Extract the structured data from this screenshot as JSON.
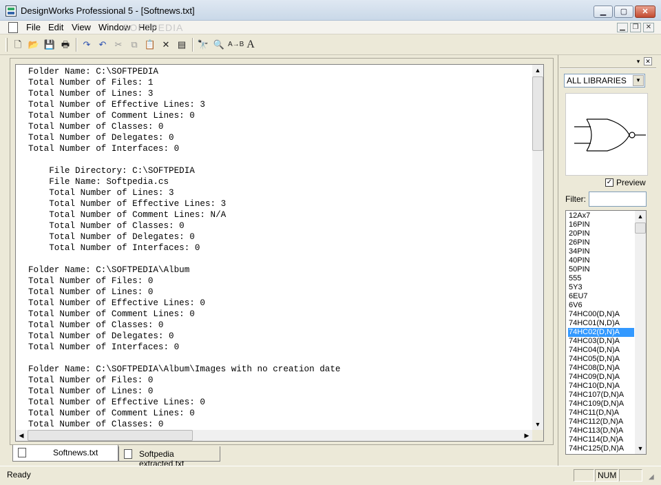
{
  "window": {
    "title": "DesignWorks Professional 5 - [Softnews.txt]"
  },
  "menu": [
    "File",
    "Edit",
    "View",
    "Window",
    "Help"
  ],
  "watermark": "SOFTPEDIA",
  "toolbar": [
    "new-icon",
    "open-icon",
    "save-icon",
    "print-icon",
    "redo-icon",
    "undo-icon",
    "cut-icon",
    "copy-icon",
    "paste-icon",
    "delete-icon",
    "properties-icon",
    "find-icon",
    "find-next-icon",
    "replace-icon",
    "font-icon"
  ],
  "editor": {
    "lines": [
      "Folder Name: C:\\SOFTPEDIA",
      "Total Number of Files: 1",
      "Total Number of Lines: 3",
      "Total Number of Effective Lines: 3",
      "Total Number of Comment Lines: 0",
      "Total Number of Classes: 0",
      "Total Number of Delegates: 0",
      "Total Number of Interfaces: 0",
      "",
      "    File Directory: C:\\SOFTPEDIA",
      "    File Name: Softpedia.cs",
      "    Total Number of Lines: 3",
      "    Total Number of Effective Lines: 3",
      "    Total Number of Comment Lines: N/A",
      "    Total Number of Classes: 0",
      "    Total Number of Delegates: 0",
      "    Total Number of Interfaces: 0",
      "",
      "Folder Name: C:\\SOFTPEDIA\\Album",
      "Total Number of Files: 0",
      "Total Number of Lines: 0",
      "Total Number of Effective Lines: 0",
      "Total Number of Comment Lines: 0",
      "Total Number of Classes: 0",
      "Total Number of Delegates: 0",
      "Total Number of Interfaces: 0",
      "",
      "Folder Name: C:\\SOFTPEDIA\\Album\\Images with no creation date",
      "Total Number of Files: 0",
      "Total Number of Lines: 0",
      "Total Number of Effective Lines: 0",
      "Total Number of Comment Lines: 0",
      "Total Number of Classes: 0"
    ]
  },
  "tabs": [
    {
      "label": "Softnews.txt",
      "active": true
    },
    {
      "label": "Softpedia extracted.txt",
      "active": false
    }
  ],
  "status": {
    "text": "Ready",
    "num": "NUM"
  },
  "panel": {
    "library": "ALL LIBRARIES",
    "preview_label": "Preview",
    "preview_checked": true,
    "filter_label": "Filter:",
    "filter_value": "",
    "items": [
      "12Ax7",
      "16PIN",
      "20PIN",
      "26PIN",
      "34PIN",
      "40PIN",
      "50PIN",
      "555",
      "5Y3",
      "6EU7",
      "6V6",
      "74HC00(D,N)A",
      "74HC01(N,D)A",
      "74HC02(D,N)A",
      "74HC03(D,N)A",
      "74HC04(D,N)A",
      "74HC05(D,N)A",
      "74HC08(D,N)A",
      "74HC09(D,N)A",
      "74HC10(D,N)A",
      "74HC107(D,N)A",
      "74HC109(D,N)A",
      "74HC11(D,N)A",
      "74HC112(D,N)A",
      "74HC113(D,N)A",
      "74HC114(D,N)A",
      "74HC125(D,N)A"
    ],
    "selected_index": 13
  }
}
